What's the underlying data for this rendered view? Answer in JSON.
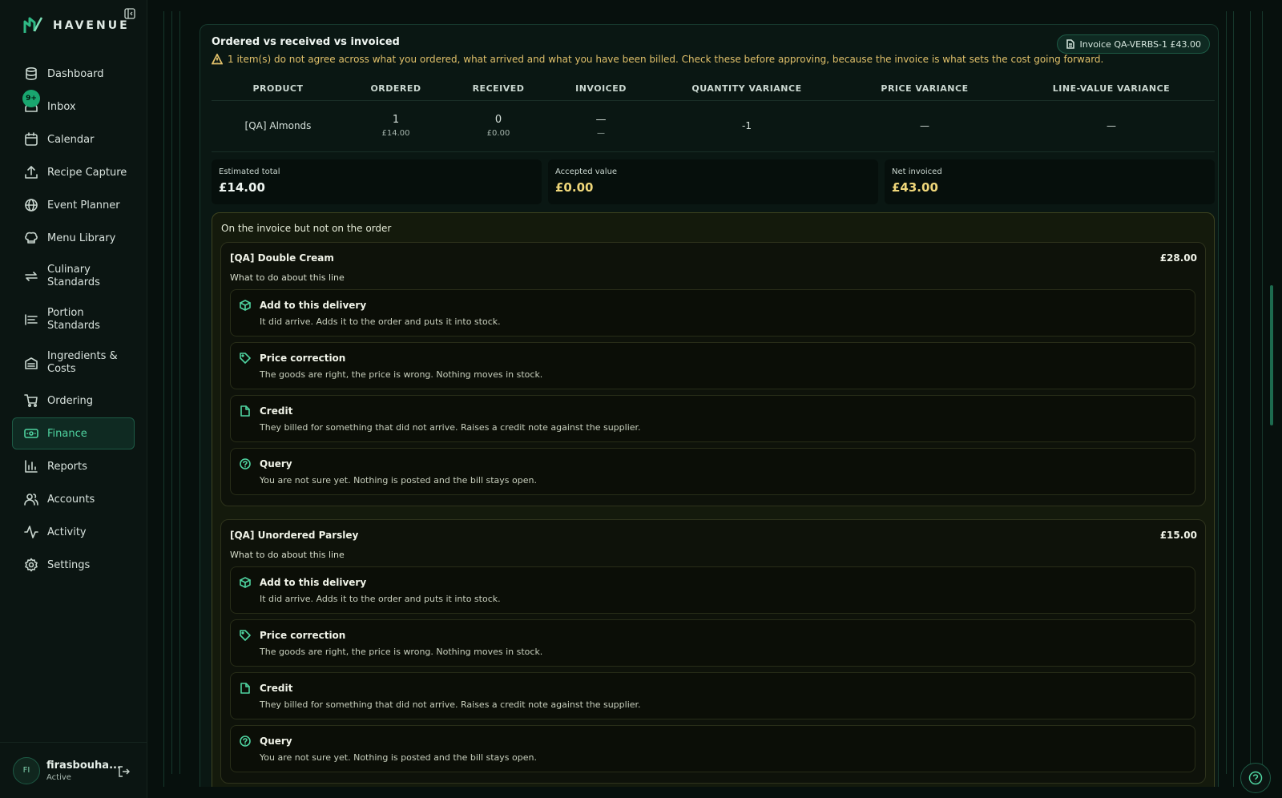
{
  "brand": {
    "name": "HAVENUE"
  },
  "sidebar": {
    "items": [
      {
        "label": "Dashboard",
        "icon": "database-icon"
      },
      {
        "label": "Inbox",
        "icon": "inbox-icon",
        "badge": "9+"
      },
      {
        "label": "Calendar",
        "icon": "calendar-icon"
      },
      {
        "label": "Recipe Capture",
        "icon": "upload-icon"
      },
      {
        "label": "Event Planner",
        "icon": "globe-icon"
      },
      {
        "label": "Menu Library",
        "icon": "chef-hat-icon"
      },
      {
        "label": "Culinary Standards",
        "icon": "repeat-icon"
      },
      {
        "label": "Portion Standards",
        "icon": "list-icon"
      },
      {
        "label": "Ingredients & Costs",
        "icon": "warehouse-icon"
      },
      {
        "label": "Ordering",
        "icon": "cart-icon"
      },
      {
        "label": "Finance",
        "icon": "banknote-icon",
        "active": true
      },
      {
        "label": "Reports",
        "icon": "bar-chart-icon"
      },
      {
        "label": "Accounts",
        "icon": "users-icon"
      },
      {
        "label": "Activity",
        "icon": "activity-icon"
      },
      {
        "label": "Settings",
        "icon": "gear-icon"
      }
    ]
  },
  "user": {
    "initials": "FI",
    "name": "firasbouha...",
    "status": "Active"
  },
  "comparison": {
    "title": "Ordered vs received vs invoiced",
    "warning": "1 item(s) do not agree across what you ordered, what arrived and what you have been billed. Check these before approving, because the invoice is what sets the cost going forward.",
    "invoice_label": "Invoice QA-VERBS-1  £43.00",
    "columns": [
      "PRODUCT",
      "ORDERED",
      "RECEIVED",
      "INVOICED",
      "QUANTITY VARIANCE",
      "PRICE VARIANCE",
      "LINE-VALUE VARIANCE"
    ],
    "rows": [
      {
        "product": "[QA] Almonds",
        "ordered_qty": "1",
        "ordered_value": "£14.00",
        "received_qty": "0",
        "received_value": "£0.00",
        "invoiced_qty": "—",
        "invoiced_value": "—",
        "quantity_variance": "-1",
        "price_variance": "—",
        "line_value_variance": "—"
      }
    ]
  },
  "totals": {
    "estimated_label": "Estimated total",
    "estimated_value": "£14.00",
    "accepted_label": "Accepted value",
    "accepted_value": "£0.00",
    "net_label": "Net invoiced",
    "net_value": "£43.00"
  },
  "unordered": {
    "title": "On the invoice but not on the order",
    "question": "What to do about this line",
    "lines": [
      {
        "name": "[QA] Double Cream",
        "amount": "£28.00"
      },
      {
        "name": "[QA] Unordered Parsley",
        "amount": "£15.00"
      }
    ],
    "options": [
      {
        "title": "Add to this delivery",
        "desc": "It did arrive. Adds it to the order and puts it into stock.",
        "icon": "package-icon"
      },
      {
        "title": "Price correction",
        "desc": "The goods are right, the price is wrong. Nothing moves in stock.",
        "icon": "tag-icon"
      },
      {
        "title": "Credit",
        "desc": "They billed for something that did not arrive. Raises a credit note against the supplier.",
        "icon": "file-icon"
      },
      {
        "title": "Query",
        "desc": "You are not sure yet. Nothing is posted and the bill stays open.",
        "icon": "help-circle-icon"
      }
    ]
  },
  "colors": {
    "accent": "#4fd3a0",
    "warning": "#e0c06a",
    "background": "#07100d"
  }
}
